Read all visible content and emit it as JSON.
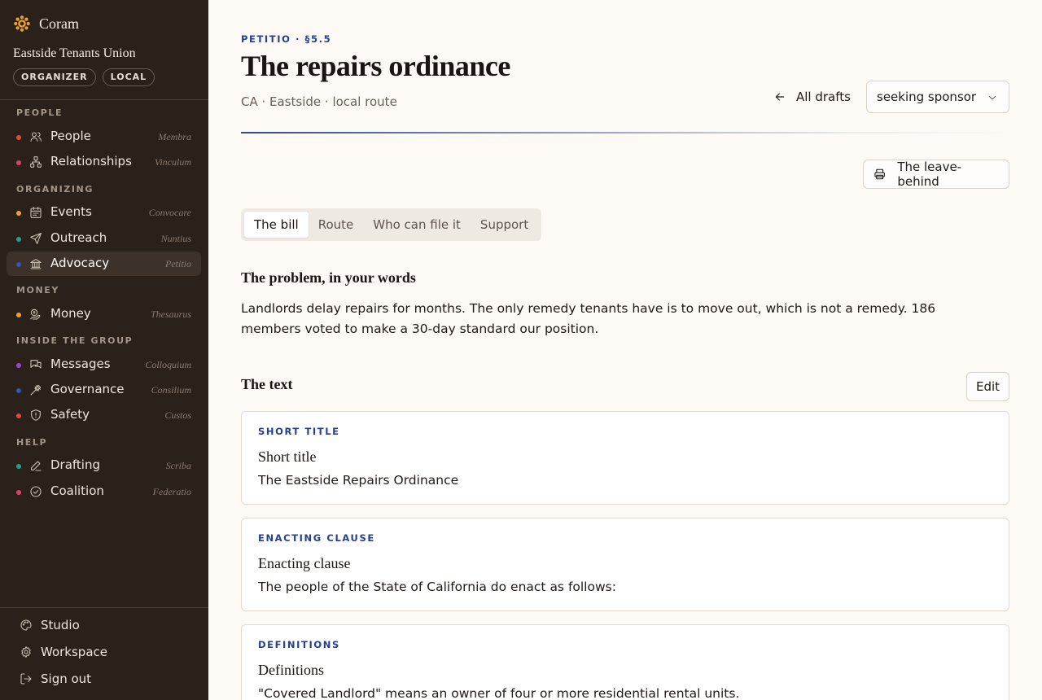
{
  "sidebar": {
    "brand": "Coram",
    "org_name": "Eastside Tenants Union",
    "badges": [
      "ORGANIZER",
      "LOCAL"
    ],
    "sections": {
      "people": "PEOPLE",
      "organizing": "ORGANIZING",
      "money": "MONEY",
      "inside": "INSIDE THE GROUP",
      "help": "HELP"
    },
    "items": [
      {
        "label": "People",
        "latin": "Membra",
        "icon": "users-icon",
        "dot": "#e5483b"
      },
      {
        "label": "Relationships",
        "latin": "Vinculum",
        "icon": "network-icon",
        "dot": "#e0406e"
      },
      {
        "label": "Events",
        "latin": "Convocare",
        "icon": "calendar-icon",
        "dot": "#f0a12c"
      },
      {
        "label": "Outreach",
        "latin": "Nuntius",
        "icon": "send-icon",
        "dot": "#23a08c"
      },
      {
        "label": "Advocacy",
        "latin": "Petitio",
        "icon": "landmark-icon",
        "dot": "#3852b8",
        "active": true
      },
      {
        "label": "Money",
        "latin": "Thesaurus",
        "icon": "money-icon",
        "dot": "#f0a12c"
      },
      {
        "label": "Messages",
        "latin": "Colloquium",
        "icon": "messages-icon",
        "dot": "#9b47c9"
      },
      {
        "label": "Governance",
        "latin": "Consilium",
        "icon": "gavel-icon",
        "dot": "#3852b8"
      },
      {
        "label": "Safety",
        "latin": "Custos",
        "icon": "shield-icon",
        "dot": "#e5483b"
      },
      {
        "label": "Drafting",
        "latin": "Scriba",
        "icon": "pen-icon",
        "dot": "#23a08c"
      },
      {
        "label": "Coalition",
        "latin": "Federatio",
        "icon": "check-circle-icon",
        "dot": "#e0406e"
      }
    ],
    "footer": [
      {
        "label": "Studio",
        "icon": "palette-icon"
      },
      {
        "label": "Workspace",
        "icon": "gear-icon"
      },
      {
        "label": "Sign out",
        "icon": "sign-out-icon"
      }
    ]
  },
  "header": {
    "eyebrow": "PETITIO · §5.5",
    "title": "The repairs ordinance",
    "subtitle": "CA · Eastside · local route",
    "back_label": "All drafts",
    "status_value": "seeking sponsor",
    "leave_behind_label": "The leave-behind"
  },
  "tabs": [
    {
      "label": "The bill",
      "active": true
    },
    {
      "label": "Route"
    },
    {
      "label": "Who can file it"
    },
    {
      "label": "Support"
    }
  ],
  "problem": {
    "heading": "The problem, in your words",
    "text": "Landlords delay repairs for months. The only remedy tenants have is to move out, which is not a remedy. 186 members voted to make a 30-day standard our position."
  },
  "text_section": {
    "heading": "The text",
    "edit_label": "Edit"
  },
  "clauses": [
    {
      "tag": "SHORT TITLE",
      "title": "Short title",
      "body": "The Eastside Repairs Ordinance"
    },
    {
      "tag": "ENACTING CLAUSE",
      "title": "Enacting clause",
      "body": "The people of the State of California do enact as follows:"
    },
    {
      "tag": "DEFINITIONS",
      "title": "Definitions",
      "body": "\"Covered Landlord\" means an owner of four or more residential rental units."
    }
  ],
  "colors": {
    "accent": "#24408e",
    "sidebar_bg": "#2a211b",
    "page_bg": "#fdf9f5",
    "brand_mark": "#f0a12c"
  }
}
